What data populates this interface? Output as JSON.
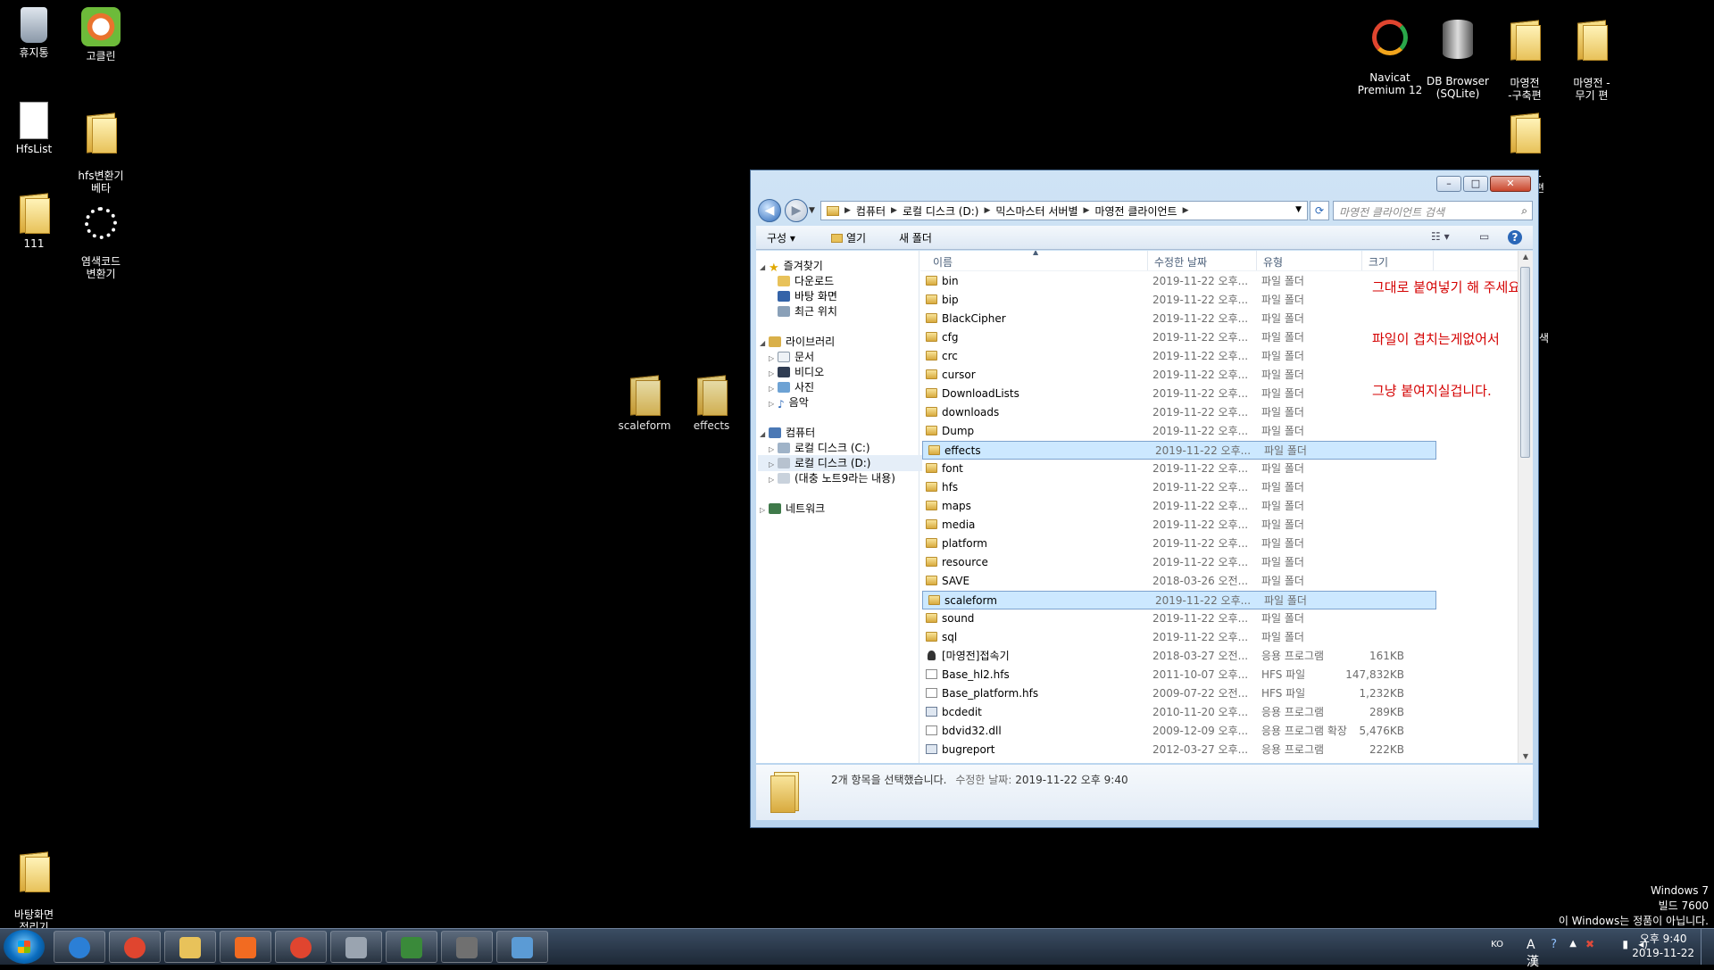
{
  "desktop": {
    "icons_left": [
      {
        "label": "휴지통",
        "icon": "recycle-bin-icon"
      },
      {
        "label": "고클린",
        "icon": "goclean-icon"
      },
      {
        "label": "HfsList",
        "icon": "file-icon"
      },
      {
        "label": "hfs변환기\n베타",
        "icon": "folder-icon"
      },
      {
        "label": "111",
        "icon": "folder-icon"
      },
      {
        "label": "염색코드\n변환기",
        "icon": "gear-icon"
      },
      {
        "label": "바탕화면\n정리기",
        "icon": "folder-icon"
      }
    ],
    "icons_right": [
      {
        "label": "Navicat\nPremium 12",
        "icon": "navicat-icon"
      },
      {
        "label": "DB Browser\n(SQLite)",
        "icon": "database-icon"
      },
      {
        "label": "마영전\n-구축편",
        "icon": "folder-icon"
      },
      {
        "label": "마영전 -\n무기 편",
        "icon": "folder-icon"
      },
      {
        "label": "마영전-\n아이템편",
        "icon": "folder-icon"
      }
    ],
    "dragging": [
      {
        "label": "scaleform"
      },
      {
        "label": "effects"
      }
    ],
    "partial_label": "색",
    "watermark": {
      "line1": "Windows 7",
      "line2": "빌드 7600",
      "line3": "이 Windows는 정품이 아닙니다."
    }
  },
  "explorer": {
    "breadcrumb": [
      "컴퓨터",
      "로컬 디스크 (D:)",
      "믹스마스터 서버별",
      "마영전 클라이언트"
    ],
    "search_placeholder": "마영전 클라이언트 검색",
    "toolbar": {
      "organize": "구성",
      "open": "열기",
      "new_folder": "새 폴더"
    },
    "nav": {
      "favorites": "즐겨찾기",
      "downloads": "다운로드",
      "desktop": "바탕 화면",
      "recent": "최근 위치",
      "libraries": "라이브러리",
      "documents": "문서",
      "videos": "비디오",
      "pictures": "사진",
      "music": "음악",
      "computer": "컴퓨터",
      "drive_c": "로컬 디스크 (C:)",
      "drive_d": "로컬 디스크 (D:)",
      "drive_other": "(대충 노트9라는 내용)",
      "network": "네트워크"
    },
    "columns": {
      "name": "이름",
      "date": "수정한 날짜",
      "type": "유형",
      "size": "크기"
    },
    "files": [
      {
        "name": "bin",
        "date": "2019-11-22 오후...",
        "type": "파일 폴더",
        "size": "",
        "kind": "folder"
      },
      {
        "name": "bip",
        "date": "2019-11-22 오후...",
        "type": "파일 폴더",
        "size": "",
        "kind": "folder"
      },
      {
        "name": "BlackCipher",
        "date": "2019-11-22 오후...",
        "type": "파일 폴더",
        "size": "",
        "kind": "folder"
      },
      {
        "name": "cfg",
        "date": "2019-11-22 오후...",
        "type": "파일 폴더",
        "size": "",
        "kind": "folder"
      },
      {
        "name": "crc",
        "date": "2019-11-22 오후...",
        "type": "파일 폴더",
        "size": "",
        "kind": "folder"
      },
      {
        "name": "cursor",
        "date": "2019-11-22 오후...",
        "type": "파일 폴더",
        "size": "",
        "kind": "folder"
      },
      {
        "name": "DownloadLists",
        "date": "2019-11-22 오후...",
        "type": "파일 폴더",
        "size": "",
        "kind": "folder"
      },
      {
        "name": "downloads",
        "date": "2019-11-22 오후...",
        "type": "파일 폴더",
        "size": "",
        "kind": "folder"
      },
      {
        "name": "Dump",
        "date": "2019-11-22 오후...",
        "type": "파일 폴더",
        "size": "",
        "kind": "folder"
      },
      {
        "name": "effects",
        "date": "2019-11-22 오후...",
        "type": "파일 폴더",
        "size": "",
        "kind": "folder",
        "selected": true
      },
      {
        "name": "font",
        "date": "2019-11-22 오후...",
        "type": "파일 폴더",
        "size": "",
        "kind": "folder"
      },
      {
        "name": "hfs",
        "date": "2019-11-22 오후...",
        "type": "파일 폴더",
        "size": "",
        "kind": "folder"
      },
      {
        "name": "maps",
        "date": "2019-11-22 오후...",
        "type": "파일 폴더",
        "size": "",
        "kind": "folder"
      },
      {
        "name": "media",
        "date": "2019-11-22 오후...",
        "type": "파일 폴더",
        "size": "",
        "kind": "folder"
      },
      {
        "name": "platform",
        "date": "2019-11-22 오후...",
        "type": "파일 폴더",
        "size": "",
        "kind": "folder"
      },
      {
        "name": "resource",
        "date": "2019-11-22 오후...",
        "type": "파일 폴더",
        "size": "",
        "kind": "folder"
      },
      {
        "name": "SAVE",
        "date": "2018-03-26 오전...",
        "type": "파일 폴더",
        "size": "",
        "kind": "folder"
      },
      {
        "name": "scaleform",
        "date": "2019-11-22 오후...",
        "type": "파일 폴더",
        "size": "",
        "kind": "folder",
        "selected": true
      },
      {
        "name": "sound",
        "date": "2019-11-22 오후...",
        "type": "파일 폴더",
        "size": "",
        "kind": "folder"
      },
      {
        "name": "sql",
        "date": "2019-11-22 오후...",
        "type": "파일 폴더",
        "size": "",
        "kind": "folder"
      },
      {
        "name": "[마영전]접속기",
        "date": "2018-03-27 오전...",
        "type": "응용 프로그램",
        "size": "161KB",
        "kind": "person"
      },
      {
        "name": "Base_hl2.hfs",
        "date": "2011-10-07 오후...",
        "type": "HFS 파일",
        "size": "147,832KB",
        "kind": "file"
      },
      {
        "name": "Base_platform.hfs",
        "date": "2009-07-22 오전...",
        "type": "HFS 파일",
        "size": "1,232KB",
        "kind": "file"
      },
      {
        "name": "bcdedit",
        "date": "2010-11-20 오후...",
        "type": "응용 프로그램",
        "size": "289KB",
        "kind": "app"
      },
      {
        "name": "bdvid32.dll",
        "date": "2009-12-09 오후...",
        "type": "응용 프로그램 확장",
        "size": "5,476KB",
        "kind": "file"
      },
      {
        "name": "bugreport",
        "date": "2012-03-27 오후...",
        "type": "응용 프로그램",
        "size": "222KB",
        "kind": "app"
      }
    ],
    "note": {
      "line1": "그대로 붙여넣기 해 주세요",
      "line2": "파일이 겹치는게없어서",
      "line3": "그냥 붙여지실겁니다."
    },
    "details": {
      "selected": "2개 항목을 선택했습니다.",
      "modified_label": "수정한 날짜:",
      "modified_value": "2019-11-22 오후 9:40"
    }
  },
  "taskbar": {
    "apps": [
      "internet-explorer-icon",
      "chrome-icon",
      "explorer-icon",
      "xampp-icon",
      "navicat-icon",
      "gear-icon",
      "notepad-icon",
      "database-icon",
      "paint-icon"
    ],
    "tray": {
      "lang": "KO",
      "ime": "A 漢"
    },
    "clock_time": "오후 9:40",
    "clock_date": "2019-11-22"
  },
  "colors": {
    "note": "#d40000",
    "selection": "#cce8ff",
    "taskbar": "#2a3a4f"
  }
}
